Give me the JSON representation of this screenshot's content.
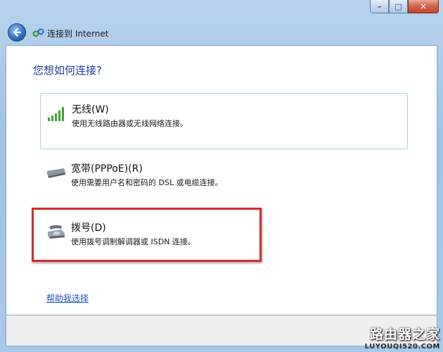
{
  "window": {
    "caption_buttons": {
      "minimize": "–",
      "maximize": "□",
      "close": "✕"
    }
  },
  "nav": {
    "back_icon": "back-arrow-icon",
    "title_icon": "network-icon",
    "title": "连接到 Internet"
  },
  "main": {
    "heading": "您想如何连接?",
    "options": [
      {
        "title": "无线(W)",
        "desc": "使用无线路由器或无线网络连接。",
        "icon": "wireless-signal-icon"
      },
      {
        "title": "宽带(PPPoE)(R)",
        "desc": "使用需要用户名和密码的 DSL 或电缆连接。",
        "icon": "broadband-modem-icon"
      },
      {
        "title": "拨号(D)",
        "desc": "使用拨号调制解调器或 ISDN 连接。",
        "icon": "dialup-phone-icon"
      }
    ],
    "help_link": "帮助我选择"
  },
  "watermark": {
    "cn": "路由器之家",
    "en": "LUYOUQI520.COM"
  },
  "colors": {
    "heading": "#1e3f9a",
    "link": "#1c55b8",
    "highlight": "#d42b2b",
    "selected_border": "#9ed3e6"
  }
}
